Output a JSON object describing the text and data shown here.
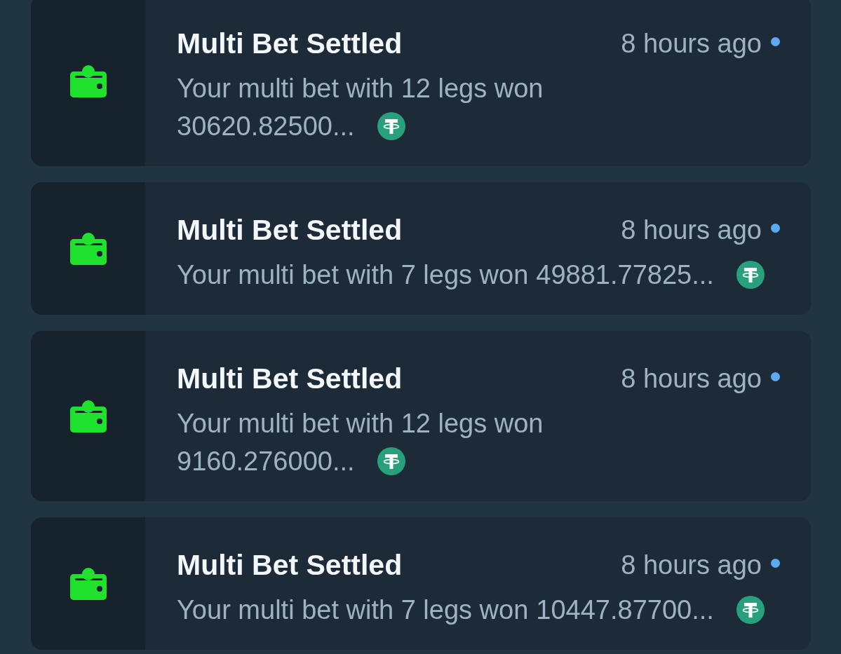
{
  "notifications": [
    {
      "title": "Multi Bet Settled",
      "time": "8 hours ago",
      "unread": true,
      "message": "Your multi bet with 12 legs won",
      "amount": "30620.82500..."
    },
    {
      "title": "Multi Bet Settled",
      "time": "8 hours ago",
      "unread": true,
      "message": "Your multi bet with 7 legs won",
      "amount": "49881.77825..."
    },
    {
      "title": "Multi Bet Settled",
      "time": "8 hours ago",
      "unread": true,
      "message": "Your multi bet with 12 legs won",
      "amount": "9160.276000..."
    },
    {
      "title": "Multi Bet Settled",
      "time": "8 hours ago",
      "unread": true,
      "message": "Your multi bet with 7 legs won",
      "amount": "10447.87700..."
    }
  ]
}
